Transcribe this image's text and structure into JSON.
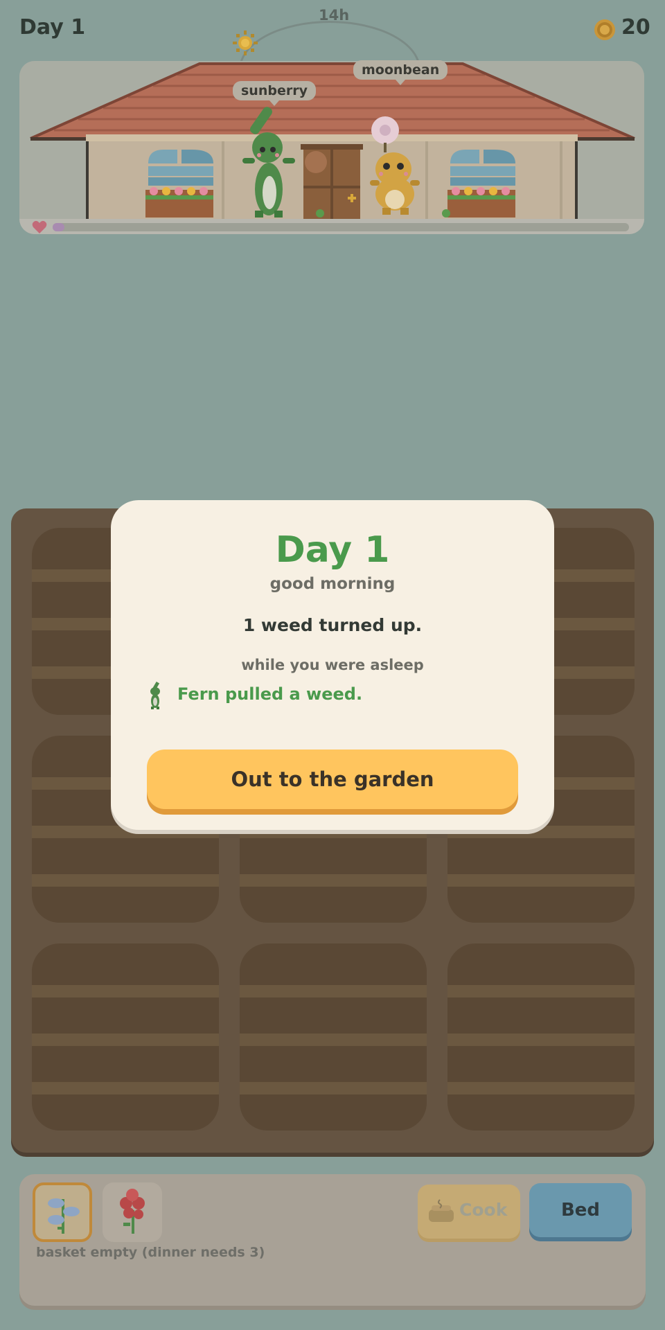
{
  "hud": {
    "day": "Day 1",
    "time": "14h",
    "coins": "20",
    "sun_icon": "sun-icon",
    "coin_icon": "coin-icon"
  },
  "characters": [
    {
      "name": "sunberry",
      "color": "#4f8a4a"
    },
    {
      "name": "moonbean",
      "color": "#d2a344"
    }
  ],
  "house": {
    "happiness": 0.02
  },
  "garden": {
    "plots": 9
  },
  "basket": {
    "seeds": [
      {
        "name": "blue-flower-seed-icon",
        "selected": true
      },
      {
        "name": "red-berry-seed-icon",
        "selected": false
      }
    ],
    "text": "basket empty (dinner needs 3)"
  },
  "actions": {
    "cook": "Cook",
    "bed": "Bed"
  },
  "modal": {
    "title": "Day 1",
    "subtitle": "good morning",
    "summary": "1 weed turned up.",
    "section": "while you were asleep",
    "event": "Fern pulled a weed.",
    "button": "Out to the garden"
  },
  "colors": {
    "background": "#889f99",
    "accent_green": "#4a9a4c",
    "button_yellow": "#ffc55e",
    "bed_blue": "#6a98ad"
  }
}
